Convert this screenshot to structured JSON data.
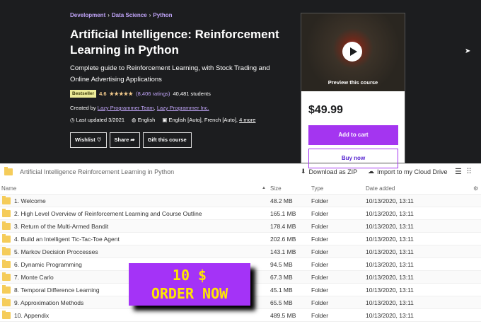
{
  "breadcrumb": [
    "Development",
    "Data Science",
    "Python"
  ],
  "course": {
    "title": "Artificial Intelligence: Reinforcement Learning in Python",
    "subtitle": "Complete guide to Reinforcement Learning, with Stock Trading and Online Advertising Applications",
    "badge": "Bestseller",
    "rating": "4.6",
    "stars": "★★★★★",
    "ratings_count": "(8,406 ratings)",
    "students": "40,481 students",
    "created_by_label": "Created by",
    "authors": [
      "Lazy Programmer Team",
      "Lazy Programmer Inc."
    ],
    "last_updated": "Last updated 3/2021",
    "language": "English",
    "captions": "English [Auto], French [Auto],",
    "more": "4 more"
  },
  "buttons": {
    "wishlist": "Wishlist ♡",
    "share": "Share ➦",
    "gift": "Gift this course"
  },
  "card": {
    "preview": "Preview this course",
    "price": "$49.99",
    "add_to_cart": "Add to cart",
    "buy_now": "Buy now"
  },
  "files": {
    "folder_title": "Artificial Intelligence Reinforcement Learning in Python",
    "download": "Download as ZIP",
    "import": "Import to my Cloud Drive",
    "columns": [
      "Name",
      "Size",
      "Type",
      "Date added"
    ],
    "rows": [
      {
        "name": "1. Welcome",
        "size": "48.2 MB",
        "type": "Folder",
        "date": "10/13/2020, 13:11"
      },
      {
        "name": "2. High Level Overview of Reinforcement Learning and Course Outline",
        "size": "165.1 MB",
        "type": "Folder",
        "date": "10/13/2020, 13:11"
      },
      {
        "name": "3. Return of the Multi-Armed Bandit",
        "size": "178.4 MB",
        "type": "Folder",
        "date": "10/13/2020, 13:11"
      },
      {
        "name": "4. Build an Intelligent Tic-Tac-Toe Agent",
        "size": "202.6 MB",
        "type": "Folder",
        "date": "10/13/2020, 13:11"
      },
      {
        "name": "5. Markov Decision Proccesses",
        "size": "143.1 MB",
        "type": "Folder",
        "date": "10/13/2020, 13:11"
      },
      {
        "name": "6. Dynamic Programming",
        "size": "94.5 MB",
        "type": "Folder",
        "date": "10/13/2020, 13:11"
      },
      {
        "name": "7. Monte Carlo",
        "size": "67.3 MB",
        "type": "Folder",
        "date": "10/13/2020, 13:11"
      },
      {
        "name": "8. Temporal Difference Learning",
        "size": "45.1 MB",
        "type": "Folder",
        "date": "10/13/2020, 13:11"
      },
      {
        "name": "9. Approximation Methods",
        "size": "65.5 MB",
        "type": "Folder",
        "date": "10/13/2020, 13:11"
      },
      {
        "name": "10. Appendix",
        "size": "489.5 MB",
        "type": "Folder",
        "date": "10/13/2020, 13:11"
      }
    ]
  },
  "promo": {
    "line1": "10 $",
    "line2": "ORDER NOW"
  }
}
